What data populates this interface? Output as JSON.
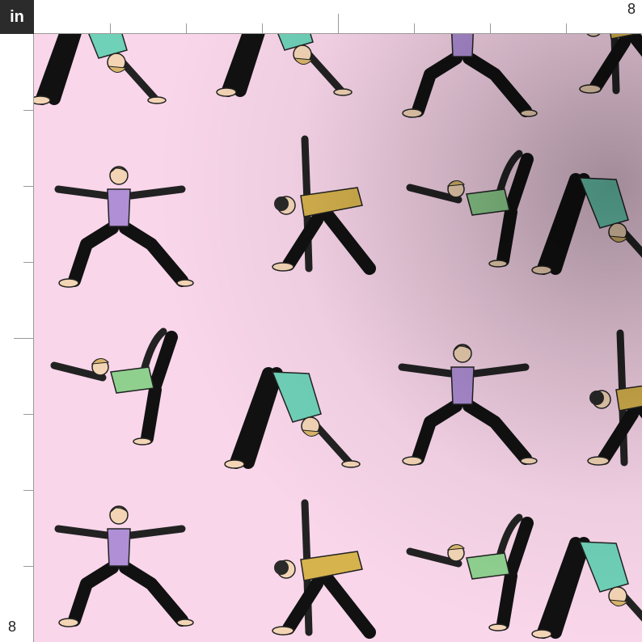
{
  "ruler": {
    "unit_label": "in",
    "top_end_label": "8",
    "left_end_label": "8"
  },
  "fabric": {
    "background_color": "#f9d6ea",
    "pattern_subject": "yoga-poses",
    "colors": {
      "purple_top": "#b08fd6",
      "teal_top": "#6fd1b8",
      "green_top": "#8fd08f",
      "mustard_top": "#d7b34e",
      "skin": "#f3d5b5",
      "hair": "#d9b56c",
      "dark_hair": "#2a2a2a",
      "pants": "#111111"
    }
  }
}
